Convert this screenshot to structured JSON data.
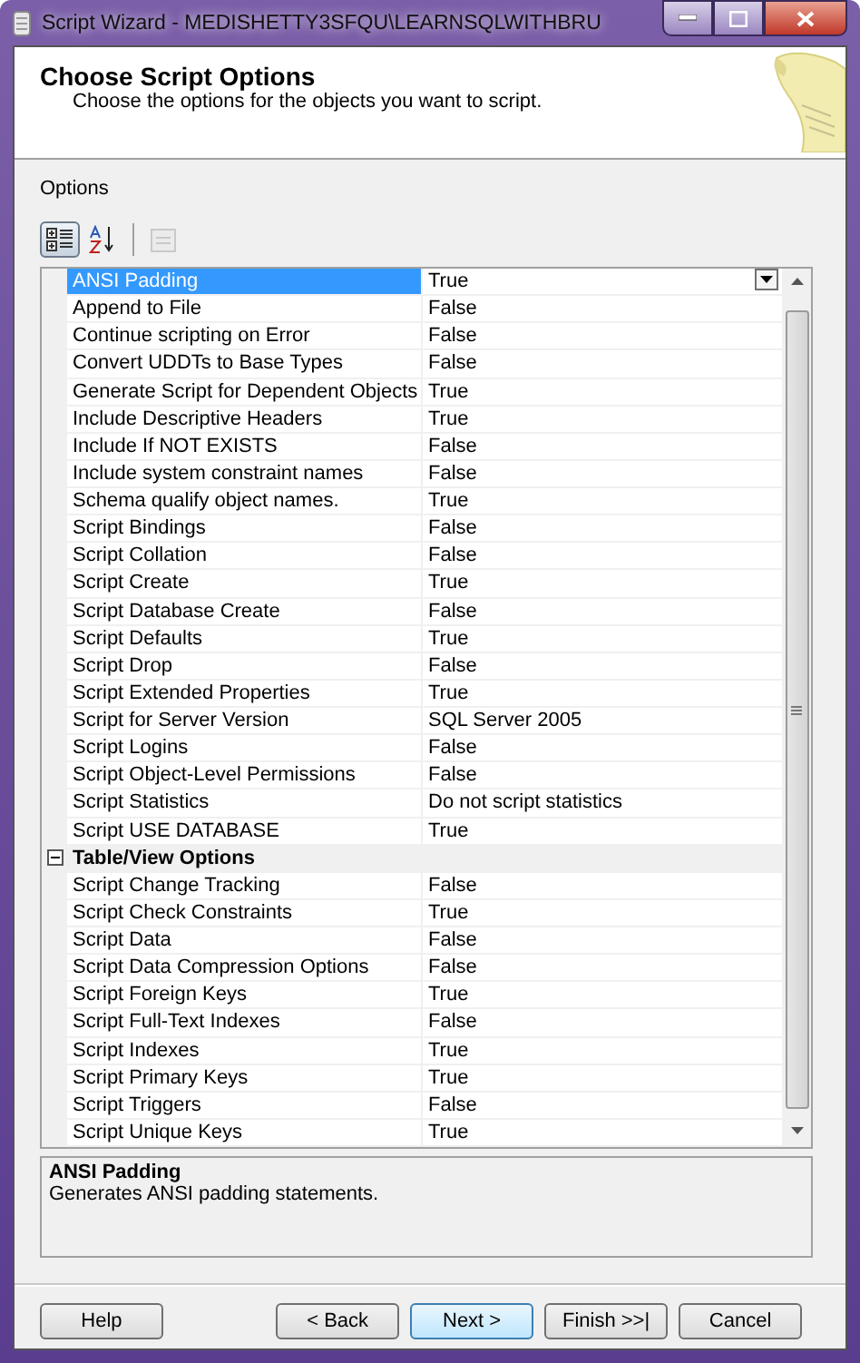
{
  "window": {
    "title": "Script Wizard - MEDISHETTY3SFQU\\LEARNSQLWITHBRU"
  },
  "header": {
    "title": "Choose Script Options",
    "subtitle": "Choose the options for the objects you want to script."
  },
  "options_label": "Options",
  "toolbar": [
    {
      "kind": "categorized",
      "selected": true,
      "disabled": false
    },
    {
      "kind": "alphabetical",
      "selected": false,
      "disabled": false
    },
    {
      "kind": "pages",
      "selected": false,
      "disabled": true
    }
  ],
  "grid": {
    "groups": [
      {
        "items": [
          {
            "name": "ANSI Padding",
            "value": "True",
            "selected": true
          },
          {
            "name": "Append to File",
            "value": "False",
            "selected": false
          },
          {
            "name": "Continue scripting on Error",
            "value": "False",
            "selected": false
          },
          {
            "name": "Convert UDDTs to Base Types",
            "value": "False",
            "selected": false
          },
          {
            "name": "Generate Script for Dependent Objects",
            "value": "True",
            "selected": false
          },
          {
            "name": "Include Descriptive Headers",
            "value": "True",
            "selected": false
          },
          {
            "name": "Include If NOT EXISTS",
            "value": "False",
            "selected": false
          },
          {
            "name": "Include system constraint names",
            "value": "False",
            "selected": false
          },
          {
            "name": "Schema qualify object names.",
            "value": "True",
            "selected": false
          },
          {
            "name": "Script Bindings",
            "value": "False",
            "selected": false
          },
          {
            "name": "Script Collation",
            "value": "False",
            "selected": false
          },
          {
            "name": "Script Create",
            "value": "True",
            "selected": false
          },
          {
            "name": "Script Database Create",
            "value": "False",
            "selected": false
          },
          {
            "name": "Script Defaults",
            "value": "True",
            "selected": false
          },
          {
            "name": "Script Drop",
            "value": "False",
            "selected": false
          },
          {
            "name": "Script Extended Properties",
            "value": "True",
            "selected": false
          },
          {
            "name": "Script for Server Version",
            "value": "SQL Server 2005",
            "selected": false
          },
          {
            "name": "Script Logins",
            "value": "False",
            "selected": false
          },
          {
            "name": "Script Object-Level Permissions",
            "value": "False",
            "selected": false
          },
          {
            "name": "Script Statistics",
            "value": "Do not script statistics",
            "selected": false
          },
          {
            "name": "Script USE DATABASE",
            "value": "True",
            "selected": false
          }
        ]
      },
      {
        "title": "Table/View Options",
        "expanded": true,
        "items": [
          {
            "name": "Script Change Tracking",
            "value": "False",
            "selected": false
          },
          {
            "name": "Script Check Constraints",
            "value": "True",
            "selected": false
          },
          {
            "name": "Script Data",
            "value": "False",
            "selected": false
          },
          {
            "name": "Script Data Compression Options",
            "value": "False",
            "selected": false
          },
          {
            "name": "Script Foreign Keys",
            "value": "True",
            "selected": false
          },
          {
            "name": "Script Full-Text Indexes",
            "value": "False",
            "selected": false
          },
          {
            "name": "Script Indexes",
            "value": "True",
            "selected": false
          },
          {
            "name": "Script Primary Keys",
            "value": "True",
            "selected": false
          },
          {
            "name": "Script Triggers",
            "value": "False",
            "selected": false
          },
          {
            "name": "Script Unique Keys",
            "value": "True",
            "selected": false
          }
        ]
      }
    ]
  },
  "description": {
    "title": "ANSI Padding",
    "text": "Generates ANSI padding statements."
  },
  "buttons": [
    {
      "label": "Help",
      "kind": "help",
      "default": false
    },
    {
      "label": "< Back",
      "kind": "nav",
      "default": false
    },
    {
      "label": "Next >",
      "kind": "nav",
      "default": true
    },
    {
      "label": "Finish >>|",
      "kind": "nav",
      "default": false
    },
    {
      "label": "Cancel",
      "kind": "nav",
      "default": false
    }
  ]
}
